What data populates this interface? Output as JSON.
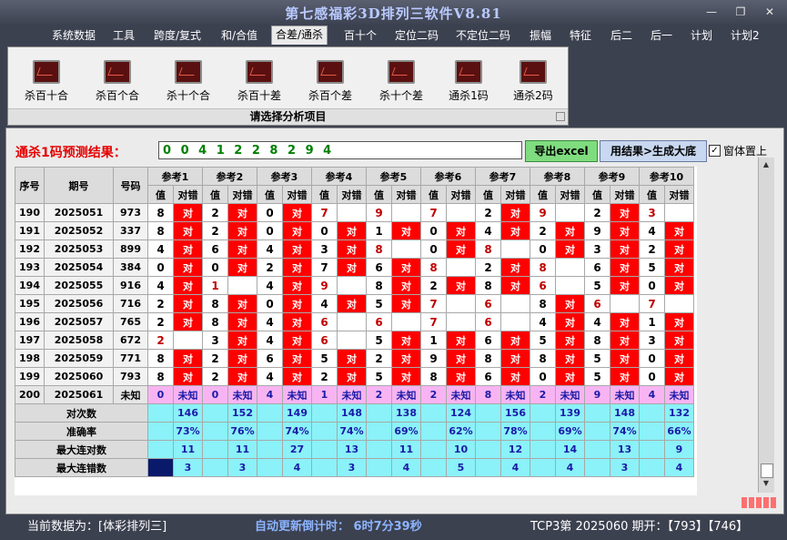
{
  "app": {
    "title": "第七感福彩3D排列三软件V8.81",
    "window_buttons": [
      "—",
      "❐",
      "✕"
    ]
  },
  "menu": [
    {
      "label": "系统数据",
      "active": false
    },
    {
      "label": "工具",
      "active": false
    },
    {
      "label": "跨度/复式",
      "active": false
    },
    {
      "label": "和/合值",
      "active": false
    },
    {
      "label": "合差/通杀",
      "active": true
    },
    {
      "label": "百十个",
      "active": false
    },
    {
      "label": "定位二码",
      "active": false
    },
    {
      "label": "不定位二码",
      "active": false
    },
    {
      "label": "振幅",
      "active": false
    },
    {
      "label": "特征",
      "active": false
    },
    {
      "label": "后二",
      "active": false
    },
    {
      "label": "后一",
      "active": false
    },
    {
      "label": "计划",
      "active": false
    },
    {
      "label": "计划2",
      "active": false
    }
  ],
  "ribbon": {
    "buttons": [
      "杀百十合",
      "杀百个合",
      "杀十个合",
      "杀百十差",
      "杀百个差",
      "杀十个差",
      "通杀1码",
      "通杀2码"
    ],
    "icon": "chart-icon",
    "caption": "请选择分析项目"
  },
  "prediction": {
    "label": "通杀1码预测结果：",
    "value": "0 0 4 1 2 2 8 2 9 4",
    "excel_button": "导出excel",
    "generate_button": "用结果>生成大底",
    "checkbox_label": "窗体置上",
    "checkbox_checked": true
  },
  "grid": {
    "headers": {
      "seq": "序号",
      "issue": "期号",
      "number": "号码",
      "value": "值",
      "result": "对错"
    },
    "refs": [
      "参考1",
      "参考2",
      "参考3",
      "参考4",
      "参考5",
      "参考6",
      "参考7",
      "参考8",
      "参考9",
      "参考10"
    ],
    "rows": [
      {
        "seq": "190",
        "issue": "2025051",
        "num": "973",
        "cells": [
          [
            "8",
            "对"
          ],
          [
            "2",
            "对"
          ],
          [
            "0",
            "对"
          ],
          [
            "7",
            "x"
          ],
          [
            "9",
            "x"
          ],
          [
            "7",
            "x"
          ],
          [
            "2",
            "对"
          ],
          [
            "9",
            "x"
          ],
          [
            "2",
            "对"
          ],
          [
            "3",
            "x"
          ]
        ]
      },
      {
        "seq": "191",
        "issue": "2025052",
        "num": "337",
        "cells": [
          [
            "8",
            "对"
          ],
          [
            "2",
            "对"
          ],
          [
            "0",
            "对"
          ],
          [
            "0",
            "对"
          ],
          [
            "1",
            "对"
          ],
          [
            "0",
            "对"
          ],
          [
            "4",
            "对"
          ],
          [
            "2",
            "对"
          ],
          [
            "9",
            "对"
          ],
          [
            "4",
            "对"
          ]
        ]
      },
      {
        "seq": "192",
        "issue": "2025053",
        "num": "899",
        "cells": [
          [
            "4",
            "对"
          ],
          [
            "6",
            "对"
          ],
          [
            "4",
            "对"
          ],
          [
            "3",
            "对"
          ],
          [
            "8",
            "x"
          ],
          [
            "0",
            "对"
          ],
          [
            "8",
            "x"
          ],
          [
            "0",
            "对"
          ],
          [
            "3",
            "对"
          ],
          [
            "2",
            "对"
          ]
        ]
      },
      {
        "seq": "193",
        "issue": "2025054",
        "num": "384",
        "cells": [
          [
            "0",
            "对"
          ],
          [
            "0",
            "对"
          ],
          [
            "2",
            "对"
          ],
          [
            "7",
            "对"
          ],
          [
            "6",
            "对"
          ],
          [
            "8",
            "x"
          ],
          [
            "2",
            "对"
          ],
          [
            "8",
            "x"
          ],
          [
            "6",
            "对"
          ],
          [
            "5",
            "对"
          ]
        ]
      },
      {
        "seq": "194",
        "issue": "2025055",
        "num": "916",
        "cells": [
          [
            "4",
            "对"
          ],
          [
            "1",
            "x"
          ],
          [
            "4",
            "对"
          ],
          [
            "9",
            "x"
          ],
          [
            "8",
            "对"
          ],
          [
            "2",
            "对"
          ],
          [
            "8",
            "对"
          ],
          [
            "6",
            "x"
          ],
          [
            "5",
            "对"
          ],
          [
            "0",
            "对"
          ]
        ]
      },
      {
        "seq": "195",
        "issue": "2025056",
        "num": "716",
        "cells": [
          [
            "2",
            "对"
          ],
          [
            "8",
            "对"
          ],
          [
            "0",
            "对"
          ],
          [
            "4",
            "对"
          ],
          [
            "5",
            "对"
          ],
          [
            "7",
            "x"
          ],
          [
            "6",
            "x"
          ],
          [
            "8",
            "对"
          ],
          [
            "6",
            "x"
          ],
          [
            "7",
            "x"
          ]
        ]
      },
      {
        "seq": "196",
        "issue": "2025057",
        "num": "765",
        "cells": [
          [
            "2",
            "对"
          ],
          [
            "8",
            "对"
          ],
          [
            "4",
            "对"
          ],
          [
            "6",
            "x"
          ],
          [
            "6",
            "x"
          ],
          [
            "7",
            "x"
          ],
          [
            "6",
            "x"
          ],
          [
            "4",
            "对"
          ],
          [
            "4",
            "对"
          ],
          [
            "1",
            "对"
          ]
        ]
      },
      {
        "seq": "197",
        "issue": "2025058",
        "num": "672",
        "cells": [
          [
            "2",
            "x"
          ],
          [
            "3",
            "对"
          ],
          [
            "4",
            "对"
          ],
          [
            "6",
            "x"
          ],
          [
            "5",
            "对"
          ],
          [
            "1",
            "对"
          ],
          [
            "6",
            "对"
          ],
          [
            "5",
            "对"
          ],
          [
            "8",
            "对"
          ],
          [
            "3",
            "对"
          ]
        ]
      },
      {
        "seq": "198",
        "issue": "2025059",
        "num": "771",
        "cells": [
          [
            "8",
            "对"
          ],
          [
            "2",
            "对"
          ],
          [
            "6",
            "对"
          ],
          [
            "5",
            "对"
          ],
          [
            "2",
            "对"
          ],
          [
            "9",
            "对"
          ],
          [
            "8",
            "对"
          ],
          [
            "8",
            "对"
          ],
          [
            "5",
            "对"
          ],
          [
            "0",
            "对"
          ]
        ]
      },
      {
        "seq": "199",
        "issue": "2025060",
        "num": "793",
        "cells": [
          [
            "8",
            "对"
          ],
          [
            "2",
            "对"
          ],
          [
            "4",
            "对"
          ],
          [
            "2",
            "对"
          ],
          [
            "5",
            "对"
          ],
          [
            "8",
            "对"
          ],
          [
            "6",
            "对"
          ],
          [
            "0",
            "对"
          ],
          [
            "5",
            "对"
          ],
          [
            "0",
            "对"
          ]
        ]
      }
    ],
    "pending": {
      "seq": "200",
      "issue": "2025061",
      "num": "未知",
      "values": [
        "0",
        "0",
        "4",
        "1",
        "2",
        "2",
        "8",
        "2",
        "9",
        "4"
      ],
      "result": "未知"
    },
    "stats": [
      {
        "label": "对次数",
        "values": [
          "146",
          "152",
          "149",
          "148",
          "138",
          "124",
          "156",
          "139",
          "148",
          "132"
        ]
      },
      {
        "label": "准确率",
        "values": [
          "73%",
          "76%",
          "74%",
          "74%",
          "69%",
          "62%",
          "78%",
          "69%",
          "74%",
          "66%"
        ]
      },
      {
        "label": "最大连对数",
        "values": [
          "11",
          "11",
          "27",
          "13",
          "11",
          "10",
          "12",
          "14",
          "13",
          "9"
        ]
      },
      {
        "label": "最大连错数",
        "values": [
          "3",
          "3",
          "4",
          "3",
          "4",
          "5",
          "4",
          "4",
          "3",
          "4"
        ]
      }
    ]
  },
  "status": {
    "current_data": "当前数据为：[体彩排列三]",
    "countdown": "自动更新倒计时：  6时7分39秒",
    "latest": "TCP3第 2025060 期开：【793】【746】"
  },
  "colors": {
    "hit": "#ff0000",
    "unknown": "#f8b4f2",
    "stat": "#8af2f8",
    "menu_bg": "#3c4150"
  }
}
